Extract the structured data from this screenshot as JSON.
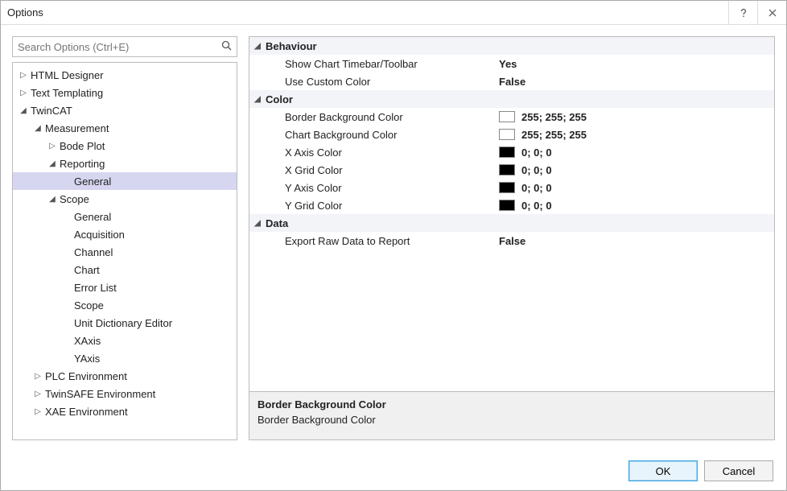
{
  "window": {
    "title": "Options"
  },
  "search": {
    "placeholder": "Search Options (Ctrl+E)"
  },
  "tree": [
    {
      "label": "HTML Designer",
      "indent": 0,
      "expanded": false,
      "leaf": false
    },
    {
      "label": "Text Templating",
      "indent": 0,
      "expanded": false,
      "leaf": false
    },
    {
      "label": "TwinCAT",
      "indent": 0,
      "expanded": true,
      "leaf": false
    },
    {
      "label": "Measurement",
      "indent": 1,
      "expanded": true,
      "leaf": false
    },
    {
      "label": "Bode Plot",
      "indent": 2,
      "expanded": false,
      "leaf": false
    },
    {
      "label": "Reporting",
      "indent": 2,
      "expanded": true,
      "leaf": false
    },
    {
      "label": "General",
      "indent": 3,
      "leaf": true,
      "selected": true
    },
    {
      "label": "Scope",
      "indent": 2,
      "expanded": true,
      "leaf": false
    },
    {
      "label": "General",
      "indent": 3,
      "leaf": true
    },
    {
      "label": "Acquisition",
      "indent": 3,
      "leaf": true
    },
    {
      "label": "Channel",
      "indent": 3,
      "leaf": true
    },
    {
      "label": "Chart",
      "indent": 3,
      "leaf": true
    },
    {
      "label": "Error List",
      "indent": 3,
      "leaf": true
    },
    {
      "label": "Scope",
      "indent": 3,
      "leaf": true
    },
    {
      "label": "Unit Dictionary Editor",
      "indent": 3,
      "leaf": true
    },
    {
      "label": "XAxis",
      "indent": 3,
      "leaf": true
    },
    {
      "label": "YAxis",
      "indent": 3,
      "leaf": true
    },
    {
      "label": "PLC Environment",
      "indent": 1,
      "expanded": false,
      "leaf": false
    },
    {
      "label": "TwinSAFE Environment",
      "indent": 1,
      "expanded": false,
      "leaf": false
    },
    {
      "label": "XAE Environment",
      "indent": 1,
      "expanded": false,
      "leaf": false
    }
  ],
  "grid": [
    {
      "type": "cat",
      "label": "Behaviour"
    },
    {
      "type": "prop",
      "label": "Show Chart Timebar/Toolbar",
      "value": "Yes"
    },
    {
      "type": "prop",
      "label": "Use Custom Color",
      "value": "False"
    },
    {
      "type": "cat",
      "label": "Color"
    },
    {
      "type": "prop",
      "label": "Border Background Color",
      "value": "255; 255; 255",
      "swatch": "#ffffff"
    },
    {
      "type": "prop",
      "label": "Chart Background Color",
      "value": "255; 255; 255",
      "swatch": "#ffffff"
    },
    {
      "type": "prop",
      "label": "X Axis Color",
      "value": "0; 0; 0",
      "swatch": "#000000"
    },
    {
      "type": "prop",
      "label": "X Grid Color",
      "value": "0; 0; 0",
      "swatch": "#000000"
    },
    {
      "type": "prop",
      "label": "Y Axis Color",
      "value": "0; 0; 0",
      "swatch": "#000000"
    },
    {
      "type": "prop",
      "label": "Y Grid Color",
      "value": "0; 0; 0",
      "swatch": "#000000"
    },
    {
      "type": "cat",
      "label": "Data"
    },
    {
      "type": "prop",
      "label": "Export Raw Data to Report",
      "value": "False"
    }
  ],
  "description": {
    "title": "Border Background Color",
    "text": "Border Background Color"
  },
  "buttons": {
    "ok": "OK",
    "cancel": "Cancel"
  }
}
